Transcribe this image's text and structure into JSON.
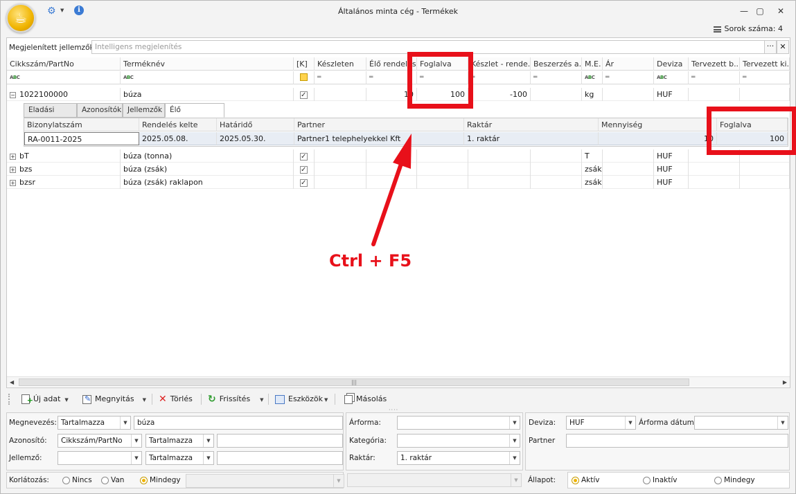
{
  "window": {
    "title": "Általános minta cég - Termékek",
    "row_count_label": "Sorok száma: 4"
  },
  "features_bar": {
    "label": "Megjelenített jellemzők:",
    "placeholder": "Intelligens megjelenítés"
  },
  "grid": {
    "columns": [
      "Cikkszám/PartNo",
      "Terméknév",
      "[K]",
      "Készleten",
      "Élő rendelés",
      "Foglalva",
      "Készlet - rende...",
      "Beszerzés a...",
      "M.E.",
      "Ár",
      "Deviza",
      "Tervezett b...",
      "Tervezett ki..."
    ],
    "rows": [
      {
        "code": "1022100000",
        "name": "búza",
        "k": true,
        "elo_rendeles": "10",
        "foglalva": "100",
        "keszlet_rendeles": "-100",
        "me": "kg",
        "deviza": "HUF"
      },
      {
        "code": "bT",
        "name": "búza (tonna)",
        "k": true,
        "me": "T",
        "deviza": "HUF"
      },
      {
        "code": "bzs",
        "name": "búza (zsák)",
        "k": true,
        "me": "zsák",
        "deviza": "HUF"
      },
      {
        "code": "bzsr",
        "name": "búza (zsák) raklapon",
        "k": true,
        "me": "zsák",
        "deviza": "HUF"
      }
    ]
  },
  "detail": {
    "tabs": [
      "Eladási árak",
      "Azonosítók",
      "Jellemzők",
      "Élő rendelések"
    ],
    "columns": [
      "Bizonylatszám",
      "Rendelés kelte",
      "Határidő",
      "Partner",
      "Raktár",
      "Mennyiség",
      "Foglalva"
    ],
    "row": {
      "bizonylat": "RA-0011-2025",
      "kelte": "2025.05.08.",
      "hatarido": "2025.05.30.",
      "partner": "Partner1 telephelyekkel Kft",
      "raktar": "1. raktár",
      "mennyiseg": "10",
      "foglalva": "100"
    }
  },
  "annotation": {
    "text": "Ctrl + F5",
    "color": "#e8101a"
  },
  "toolbar": {
    "new": "Új adat",
    "open": "Megnyitás",
    "delete": "Törlés",
    "refresh": "Frissítés",
    "tools": "Eszközök",
    "copy": "Másolás"
  },
  "filters": {
    "megnevezes_label": "Megnevezés:",
    "megnevezes_mode": "Tartalmazza",
    "megnevezes_value": "búza",
    "azonosito_label": "Azonosító:",
    "azonosito_field": "Cikkszám/PartNo",
    "azonosito_mode": "Tartalmazza",
    "jellemzo_label": "Jellemző:",
    "jellemzo_mode": "Tartalmazza",
    "arforma_label": "Árforma:",
    "kategoria_label": "Kategória:",
    "raktar_label": "Raktár:",
    "raktar_value": "1. raktár",
    "deviza_label": "Deviza:",
    "deviza_value": "HUF",
    "arforma_datum_label": "Árforma dátum:",
    "partner_label": "Partner",
    "korlatozas_label": "Korlátozás:",
    "korlatozas_options": [
      "Nincs",
      "Van",
      "Mindegy"
    ],
    "allapot_label": "Állapot:",
    "allapot_options": [
      "Aktív",
      "Inaktív",
      "Mindegy"
    ]
  },
  "colors": {
    "accent": "#f0b400",
    "highlight": "#e8101a",
    "selection": "#e8edf4"
  }
}
